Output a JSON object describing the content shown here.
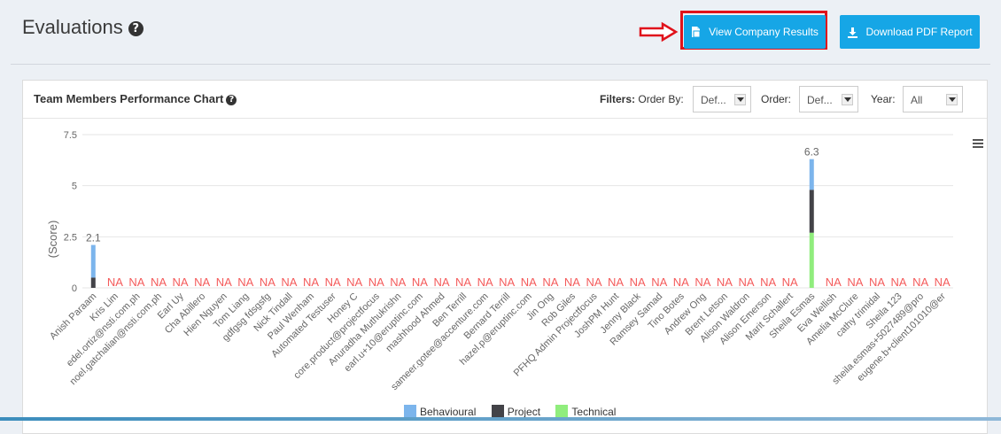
{
  "header": {
    "title": "Evaluations",
    "help_glyph": "?",
    "view_button_label": "View Company Results",
    "download_button_label": "Download PDF Report"
  },
  "card": {
    "title": "Team Members Performance Chart",
    "filters_label": "Filters:",
    "order_by_label": "Order By:",
    "order_by_value": "Def...",
    "order_label": "Order:",
    "order_value": "Def...",
    "year_label": "Year:",
    "year_value": "All"
  },
  "colors": {
    "accent": "#16a6e6",
    "highlight": "#e0121b",
    "behavioural": "#7cb5ec",
    "project": "#434348",
    "technical": "#90ed7d",
    "na": "#f45b5b"
  },
  "chart_data": {
    "type": "bar",
    "stacked": true,
    "ylabel": "(Score)",
    "ylim": [
      0,
      7.5
    ],
    "yticks": [
      "0",
      "2.5",
      "5",
      "7.5"
    ],
    "grid": true,
    "legend_position": "bottom",
    "na_label": "NA",
    "categories": [
      "Anish Paraam",
      "Kris Lim",
      "edel.ortiz@nsti.com.ph",
      "noel.gatchalian@nsti.com.ph",
      "Earl Uy",
      "Cha Abillero",
      "Hien Nguyen",
      "Tom Liang",
      "gdfgsg fdsgsfg",
      "Nick Tindall",
      "Paul Wenham",
      "Automated Testuser",
      "Honey C",
      "core.product@projectfocus",
      "Anuradha Muthukrishn",
      "earl.u+10@eruptinc.com",
      "mashhood Ahmed",
      "Ben Terrill",
      "sameer.gotee@accenture.com",
      "Bernard Terrill",
      "hazel.p@eruptinc.com",
      "Jin Ong",
      "Rob Giles",
      "PFHQ Admin Projectfocus",
      "JoshPM Hunt",
      "Jenny Black",
      "Ramsey Samad",
      "Tino Botes",
      "Andrew Ong",
      "Brent Letson",
      "Alison Waldron",
      "Alison Emerson",
      "Marit Schallert",
      "Sheila Esmas",
      "Eva Wellish",
      "Amelia McClure",
      "cathy trimidal",
      "Sheila 123",
      "sheila.esmas+5027489@pro",
      "eugene.b+client101010@er"
    ],
    "series": [
      {
        "name": "Behavioural",
        "values": [
          1.6,
          0,
          0,
          0,
          0,
          0,
          0,
          0,
          0,
          0,
          0,
          0,
          0,
          0,
          0,
          0,
          0,
          0,
          0,
          0,
          0,
          0,
          0,
          0,
          0,
          0,
          0,
          0,
          0,
          0,
          0,
          0,
          0,
          1.5,
          0,
          0,
          0,
          0,
          0,
          0
        ]
      },
      {
        "name": "Project",
        "values": [
          0.5,
          0,
          0,
          0,
          0,
          0,
          0,
          0,
          0,
          0,
          0,
          0,
          0,
          0,
          0,
          0,
          0,
          0,
          0,
          0,
          0,
          0,
          0,
          0,
          0,
          0,
          0,
          0,
          0,
          0,
          0,
          0,
          0,
          2.1,
          0,
          0,
          0,
          0,
          0,
          0
        ]
      },
      {
        "name": "Technical",
        "values": [
          0,
          0,
          0,
          0,
          0,
          0,
          0,
          0,
          0,
          0,
          0,
          0,
          0,
          0,
          0,
          0,
          0,
          0,
          0,
          0,
          0,
          0,
          0,
          0,
          0,
          0,
          0,
          0,
          0,
          0,
          0,
          0,
          0,
          2.7,
          0,
          0,
          0,
          0,
          0,
          0
        ]
      }
    ],
    "totals": [
      {
        "index": 0,
        "label": "2.1"
      },
      {
        "index": 33,
        "label": "6.3"
      }
    ]
  }
}
